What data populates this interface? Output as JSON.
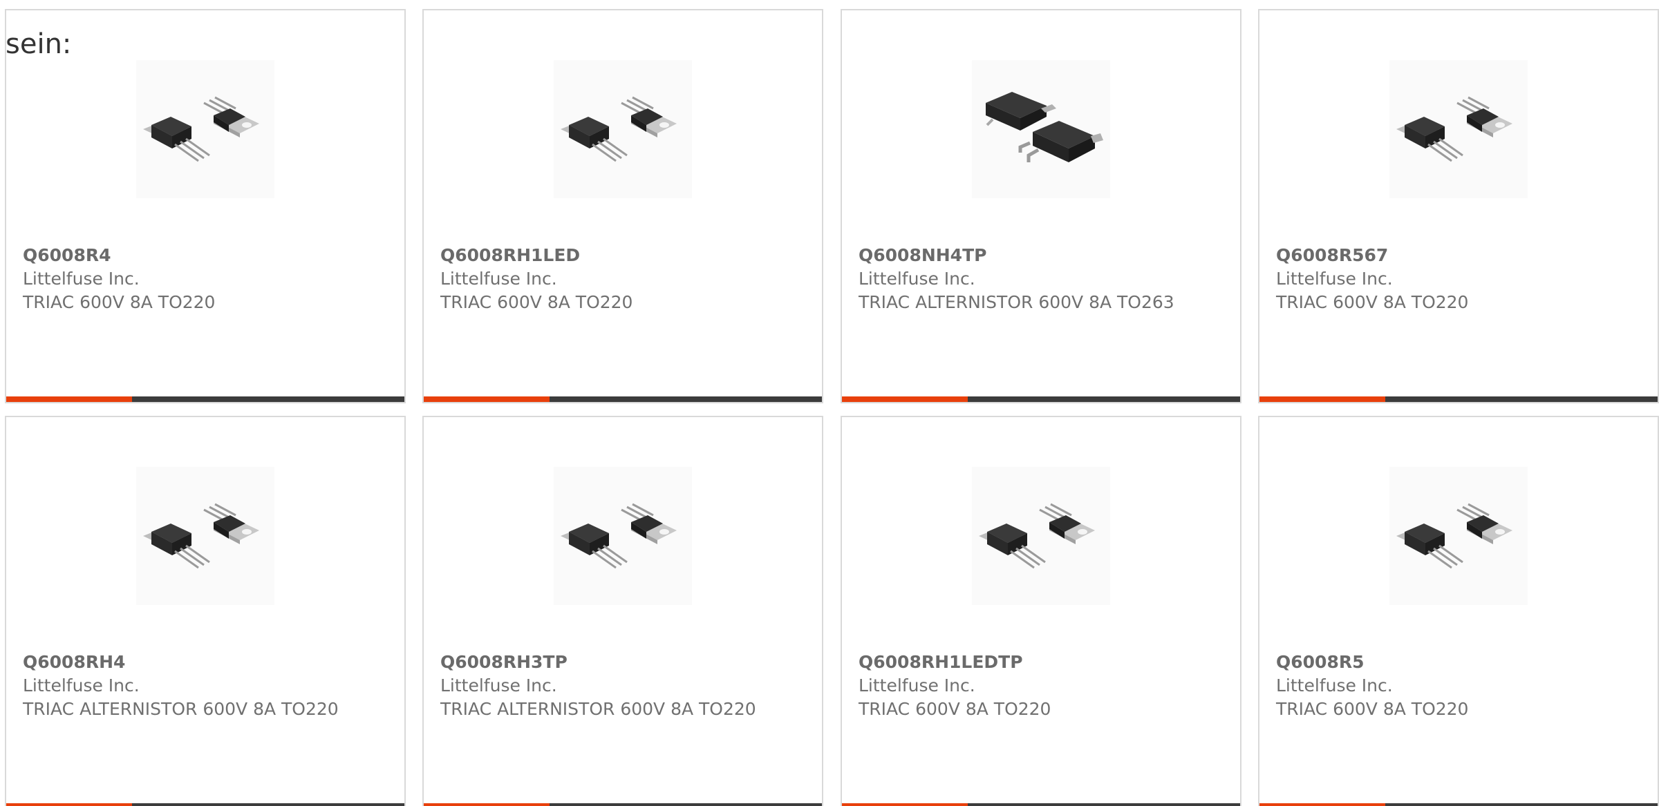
{
  "intro": {
    "text": "sein:"
  },
  "colors": {
    "accent": "#e8400c",
    "bar": "#3c3c3c",
    "border": "#d9d9d9",
    "text": "#707070"
  },
  "products": [
    {
      "part_number": "Q6008R4",
      "manufacturer": "Littelfuse Inc.",
      "description": "TRIAC 600V 8A TO220",
      "package_icon": "to220-icon"
    },
    {
      "part_number": "Q6008RH1LED",
      "manufacturer": "Littelfuse Inc.",
      "description": "TRIAC 600V 8A TO220",
      "package_icon": "to220-icon"
    },
    {
      "part_number": "Q6008NH4TP",
      "manufacturer": "Littelfuse Inc.",
      "description": "TRIAC ALTERNISTOR 600V 8A TO263",
      "package_icon": "to263-icon"
    },
    {
      "part_number": "Q6008R567",
      "manufacturer": "Littelfuse Inc.",
      "description": "TRIAC 600V 8A TO220",
      "package_icon": "to220-icon"
    },
    {
      "part_number": "Q6008RH4",
      "manufacturer": "Littelfuse Inc.",
      "description": "TRIAC ALTERNISTOR 600V 8A TO220",
      "package_icon": "to220-icon"
    },
    {
      "part_number": "Q6008RH3TP",
      "manufacturer": "Littelfuse Inc.",
      "description": "TRIAC ALTERNISTOR 600V 8A TO220",
      "package_icon": "to220-icon"
    },
    {
      "part_number": "Q6008RH1LEDTP",
      "manufacturer": "Littelfuse Inc.",
      "description": "TRIAC 600V 8A TO220",
      "package_icon": "to220-icon"
    },
    {
      "part_number": "Q6008R5",
      "manufacturer": "Littelfuse Inc.",
      "description": "TRIAC 600V 8A TO220",
      "package_icon": "to220-icon"
    }
  ]
}
